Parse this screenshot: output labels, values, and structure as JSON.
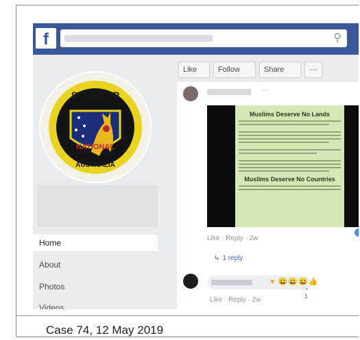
{
  "screenshot": {
    "brand": {
      "logo_letter": "f",
      "bar_color": "#3b5998"
    },
    "search": {
      "icon": "search-icon",
      "icon_glyph": "⚲"
    },
    "sidebar": {
      "logo_texts": {
        "top": "STAND UP",
        "middle": "NATIONAL",
        "bottom": "AUSTRALIA"
      },
      "nav": [
        {
          "label": "Home"
        },
        {
          "label": "About"
        },
        {
          "label": "Photos"
        },
        {
          "label": "Videos"
        }
      ]
    },
    "page_actions": {
      "like": "Like",
      "follow": "Follow",
      "share": "Share",
      "more": "···"
    },
    "post": {
      "name_dot": "···",
      "meme": {
        "heading": "Muslims Deserve No Lands",
        "footer_heading": "Muslims Deserve No Countries"
      },
      "actions": "Like · Reply · 2w",
      "replies": "1 reply",
      "reply_icon": "↳"
    },
    "comment": {
      "text": "♥ 😀😀😀👍",
      "badge": "◔ 1",
      "actions": "Like · Reply · 2w"
    }
  },
  "caption": "Case 74, 12 May 2019"
}
